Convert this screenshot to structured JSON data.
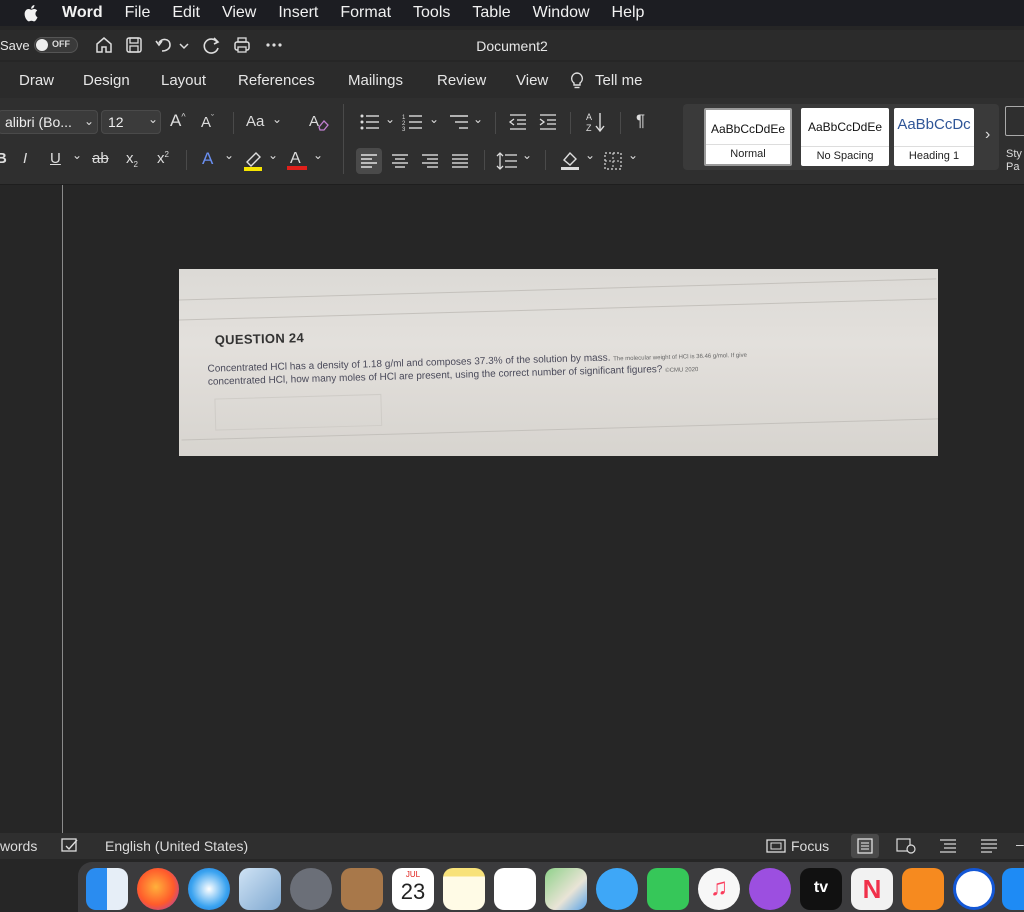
{
  "menubar": {
    "app_name": "Word",
    "items": [
      "File",
      "Edit",
      "View",
      "Insert",
      "Format",
      "Tools",
      "Table",
      "Window",
      "Help"
    ]
  },
  "titlebar": {
    "autosave_label": "Save",
    "autosave_state": "OFF",
    "document_title": "Document2"
  },
  "ribbon_tabs": [
    "Draw",
    "Design",
    "Layout",
    "References",
    "Mailings",
    "Review",
    "View"
  ],
  "tell_me": "Tell me",
  "ribbon": {
    "font_name": "alibri (Bo...",
    "font_size": "12",
    "change_case": "Aa",
    "styles": [
      {
        "sample": "AaBbCcDdEe",
        "name": "Normal"
      },
      {
        "sample": "AaBbCcDdEe",
        "name": "No Spacing"
      },
      {
        "sample": "AaBbCcDc",
        "name": "Heading 1"
      }
    ],
    "styles_pane_label": "Sty Pa"
  },
  "document": {
    "question_title": "QUESTION 24",
    "question_line1": "Concentrated HCl has a density of 1.18 g/ml and composes 37.3% of the solution by mass.",
    "question_line1_small": "The molecular weight of HCl is 36.46 g/mol. If give",
    "question_line2": "concentrated HCl, how many moles of HCl are present, using the correct number of significant figures?",
    "question_line2_small": "©CMU 2020"
  },
  "statusbar": {
    "words": "words",
    "language": "English (United States)",
    "focus": "Focus"
  },
  "dock": {
    "calendar_month": "JUL",
    "calendar_day": "23",
    "apple_tv": "tv"
  },
  "colors": {
    "highlight": "#f5e400",
    "font_color": "#e0201b",
    "heading_blue": "#2f5597"
  }
}
